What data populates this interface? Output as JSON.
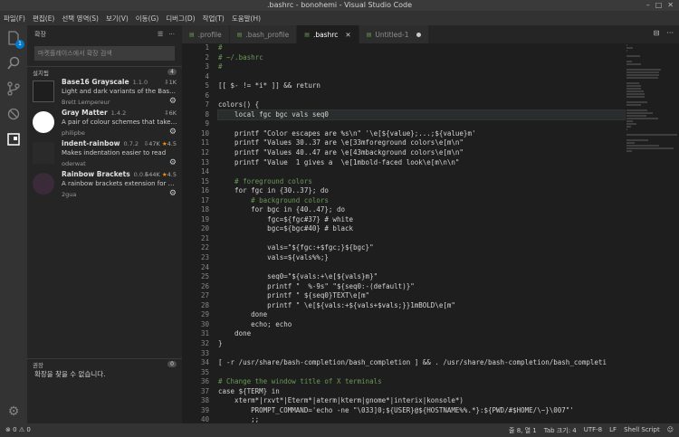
{
  "window": {
    "title": ".bashrc - bonohemi - Visual Studio Code"
  },
  "menu": [
    "파일(F)",
    "편집(E)",
    "선택 영역(S)",
    "보기(V)",
    "이동(G)",
    "디버그(D)",
    "작업(T)",
    "도움말(H)"
  ],
  "activity": {
    "extensions_badge": "1"
  },
  "sidebar": {
    "title": "확장",
    "search_placeholder": "마켓플레이스에서 확장 검색",
    "installed_label": "설치됨",
    "installed_count": "4",
    "extensions": [
      {
        "name": "Base16 Grayscale",
        "version": "1.1.0",
        "downloads": "1K",
        "rating": "",
        "desc": "Light and dark variants of the Base16...",
        "author": "Brett Lempereur"
      },
      {
        "name": "Gray Matter",
        "version": "1.4.2",
        "downloads": "6K",
        "rating": "",
        "desc": "A pair of colour schemes that take ae...",
        "author": "philipbe"
      },
      {
        "name": "indent-rainbow",
        "version": "0.7.2",
        "downloads": "47K",
        "rating": "4.5",
        "desc": "Makes indentation easier to read",
        "author": "oderwat"
      },
      {
        "name": "Rainbow Brackets",
        "version": "0.0.6",
        "downloads": "44K",
        "rating": "4.5",
        "desc": "A rainbow brackets extension for VS ...",
        "author": "2gua"
      }
    ],
    "recommended_label": "권장",
    "recommended_count": "0",
    "recommended_empty": "확장을 찾을 수 없습니다."
  },
  "tabs": [
    {
      "label": ".profile",
      "active": false
    },
    {
      "label": ".bash_profile",
      "active": false
    },
    {
      "label": ".bashrc",
      "active": true
    },
    {
      "label": "Untitled-1",
      "active": false
    }
  ],
  "editor": {
    "highlighted_line": 6,
    "lines": [
      {
        "n": "1",
        "text": "#"
      },
      {
        "n": "2",
        "text": "# ~/.bashrc"
      },
      {
        "n": "3",
        "text": "#"
      },
      {
        "n": "4",
        "text": ""
      },
      {
        "n": "5",
        "text": "[[ $- != *i* ]] && return"
      },
      {
        "n": "6",
        "text": ""
      },
      {
        "n": "7",
        "text": "colors() {"
      },
      {
        "n": "8",
        "text": "    local fgc bgc vals seq0"
      },
      {
        "n": "9",
        "text": ""
      },
      {
        "n": "10",
        "text": "    printf \"Color escapes are %s\\n\" '\\e[${value};...;${value}m'"
      },
      {
        "n": "11",
        "text": "    printf \"Values 30..37 are \\e[33mforeground colors\\e[m\\n\""
      },
      {
        "n": "12",
        "text": "    printf \"Values 40..47 are \\e[43mbackground colors\\e[m\\n\""
      },
      {
        "n": "13",
        "text": "    printf \"Value  1 gives a  \\e[1mbold-faced look\\e[m\\n\\n\""
      },
      {
        "n": "14",
        "text": ""
      },
      {
        "n": "15",
        "text": "    # foreground colors"
      },
      {
        "n": "16",
        "text": "    for fgc in {30..37}; do"
      },
      {
        "n": "17",
        "text": "        # background colors"
      },
      {
        "n": "18",
        "text": "        for bgc in {40..47}; do"
      },
      {
        "n": "19",
        "text": "            fgc=${fgc#37} # white"
      },
      {
        "n": "20",
        "text": "            bgc=${bgc#40} # black"
      },
      {
        "n": "21",
        "text": ""
      },
      {
        "n": "22",
        "text": "            vals=\"${fgc:+$fgc;}${bgc}\""
      },
      {
        "n": "23",
        "text": "            vals=${vals%%;}"
      },
      {
        "n": "24",
        "text": ""
      },
      {
        "n": "25",
        "text": "            seq0=\"${vals:+\\e[${vals}m}\""
      },
      {
        "n": "26",
        "text": "            printf \"  %-9s\" \"${seq0:-(default)}\""
      },
      {
        "n": "27",
        "text": "            printf \" ${seq0}TEXT\\e[m\""
      },
      {
        "n": "28",
        "text": "            printf \" \\e[${vals:+${vals+$vals;}}1mBOLD\\e[m\""
      },
      {
        "n": "29",
        "text": "        done"
      },
      {
        "n": "30",
        "text": "        echo; echo"
      },
      {
        "n": "31",
        "text": "    done"
      },
      {
        "n": "32",
        "text": "}"
      },
      {
        "n": "33",
        "text": ""
      },
      {
        "n": "34",
        "text": "[ -r /usr/share/bash-completion/bash_completion ] && . /usr/share/bash-completion/bash_completi"
      },
      {
        "n": "35",
        "text": ""
      },
      {
        "n": "36",
        "text": "# Change the window title of X terminals"
      },
      {
        "n": "37",
        "text": "case ${TERM} in"
      },
      {
        "n": "38",
        "text": "    xterm*|rxvt*|Eterm*|aterm|kterm|gnome*|interix|konsole*)"
      },
      {
        "n": "39",
        "text": "        PROMPT_COMMAND='echo -ne \"\\033]0;${USER}@${HOSTNAME%%.*}:${PWD/#$HOME/\\~}\\007\"'"
      },
      {
        "n": "40",
        "text": "        ;;"
      }
    ]
  },
  "status": {
    "errors": "0",
    "warnings": "0",
    "position": "줄 8, 열 1",
    "tab_size": "Tab 크기: 4",
    "encoding": "UTF-8",
    "eol": "LF",
    "language": "Shell Script"
  },
  "colors": {
    "accent": "#007acc",
    "comment": "#6a9955",
    "string": "#ce9178",
    "keyword": "#569cd6",
    "default_text": "#d4d4d4",
    "variable": "#9cdcfe"
  }
}
